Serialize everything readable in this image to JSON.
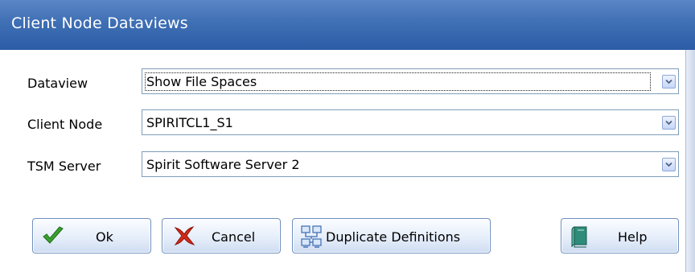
{
  "window": {
    "title": "Client Node Dataviews"
  },
  "form": {
    "dataview": {
      "label": "Dataview",
      "value": "Show File Spaces"
    },
    "client_node": {
      "label": "Client Node",
      "value": "SPIRITCL1_S1"
    },
    "tsm_server": {
      "label": "TSM Server",
      "value": "Spirit Software Server 2"
    }
  },
  "buttons": {
    "ok": "Ok",
    "cancel": "Cancel",
    "duplicate": "Duplicate Definitions",
    "help": "Help"
  },
  "icons": {
    "ok": "checkmark-icon",
    "cancel": "red-x-icon",
    "duplicate": "network-computers-icon",
    "help": "book-icon",
    "dropdown": "chevron-down-icon"
  },
  "colors": {
    "titlebar": "#3f6fb4",
    "ok_check": "#3aa12f",
    "cancel_x": "#d22a1a"
  }
}
